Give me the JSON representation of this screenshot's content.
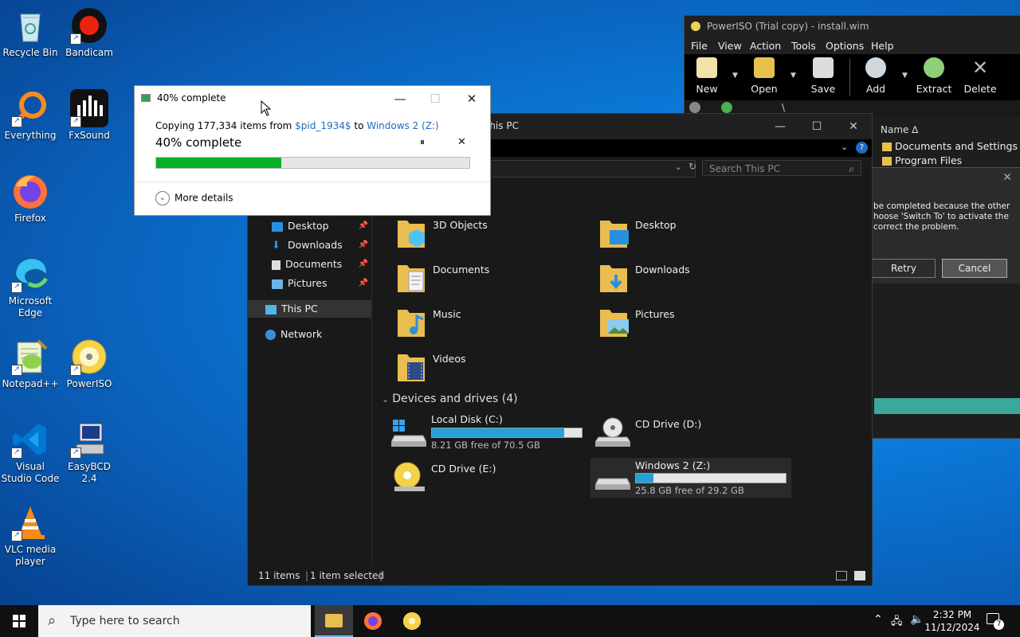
{
  "desktop": {
    "icons": [
      {
        "label": "Recycle Bin"
      },
      {
        "label": "Bandicam"
      },
      {
        "label": "Everything"
      },
      {
        "label": "FxSound"
      },
      {
        "label": "Firefox"
      },
      {
        "label": "Microsoft Edge"
      },
      {
        "label": "Notepad++"
      },
      {
        "label": "PowerISO"
      },
      {
        "label": "Visual Studio Code"
      },
      {
        "label": "EasyBCD 2.4"
      },
      {
        "label": "VLC media player"
      }
    ]
  },
  "copy_dialog": {
    "title": "40% complete",
    "line_prefix": "Copying 177,334 items from ",
    "source": "$pid_1934$",
    "to": " to ",
    "destination": "Windows 2 (Z:)",
    "percent_label": "40% complete",
    "progress": 0.4,
    "more_details": "More details",
    "pause_glyph": "⏸",
    "close_glyph": "✕"
  },
  "explorer": {
    "title": "This PC",
    "search_placeholder": "Search This PC",
    "nav": [
      {
        "label": "Desktop"
      },
      {
        "label": "Downloads"
      },
      {
        "label": "Documents"
      },
      {
        "label": "Pictures"
      },
      {
        "label": "This PC"
      },
      {
        "label": "Network"
      }
    ],
    "folders": [
      {
        "label": "3D Objects"
      },
      {
        "label": "Desktop"
      },
      {
        "label": "Documents"
      },
      {
        "label": "Downloads"
      },
      {
        "label": "Music"
      },
      {
        "label": "Pictures"
      },
      {
        "label": "Videos"
      }
    ],
    "devices_header": "Devices and drives (4)",
    "drives": [
      {
        "label": "Local Disk (C:)",
        "free": "8.21 GB free of 70.5 GB",
        "used": 0.884
      },
      {
        "label": "CD Drive (D:)"
      },
      {
        "label": "CD Drive (E:)"
      },
      {
        "label": "Windows 2 (Z:)",
        "free": "25.8 GB free of 29.2 GB",
        "used": 0.116
      }
    ],
    "status": {
      "items": "11 items",
      "selected": "1 item selected"
    }
  },
  "poweriso": {
    "title": "PowerISO (Trial copy) - install.wim",
    "menu": [
      "File",
      "View",
      "Action",
      "Tools",
      "Options",
      "Help"
    ],
    "toolbar": [
      "New",
      "Open",
      "Save",
      "Add",
      "Extract",
      "Delete"
    ],
    "path": "\\",
    "name_header": "Name",
    "files": [
      "Documents and Settings",
      "Program Files"
    ]
  },
  "error_dialog": {
    "message": "be completed because the other\nhoose 'Switch To' to activate the\ncorrect the problem.",
    "retry": "Retry",
    "cancel": "Cancel"
  },
  "taskbar": {
    "search_placeholder": "Type here to search",
    "time": "2:32 PM",
    "date": "11/12/2024",
    "notif_count": "7"
  },
  "colors": {
    "progress_green": "#06b025",
    "drive_blue": "#26a0da",
    "link_blue": "#1e6ac0"
  }
}
